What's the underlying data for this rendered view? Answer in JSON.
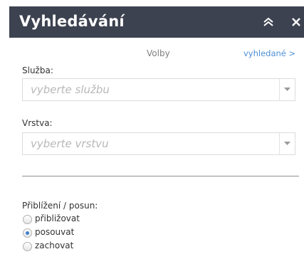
{
  "panel": {
    "title": "Vyhledávání",
    "collapse_icon": "double-chevron-up-icon",
    "close_icon": "close-icon"
  },
  "tabs": {
    "options": "Volby",
    "found": "vyhledané >"
  },
  "service": {
    "label": "Služba:",
    "placeholder": "vyberte službu"
  },
  "layer": {
    "label": "Vrstva:",
    "placeholder": "vyberte vrstvu"
  },
  "zoom": {
    "label": "Přiblížení / posun:",
    "options": [
      {
        "label": "přibližovat",
        "checked": false
      },
      {
        "label": "posouvat",
        "checked": true
      },
      {
        "label": "zachovat",
        "checked": false
      }
    ]
  },
  "colors": {
    "header_bg": "#3d4250",
    "link": "#4d8fd4",
    "radio_selected": "#3f7fcf"
  }
}
